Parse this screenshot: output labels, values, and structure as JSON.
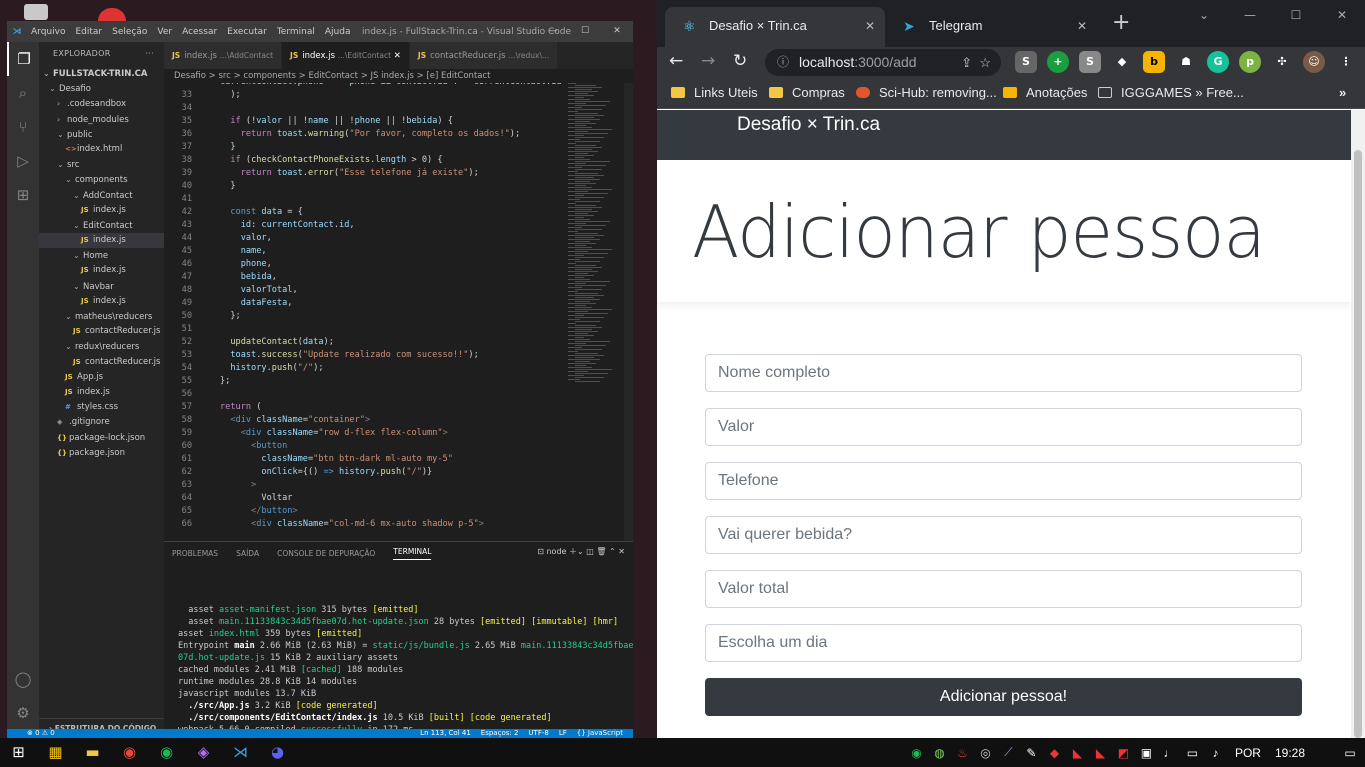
{
  "vscode": {
    "menu": [
      "Arquivo",
      "Editar",
      "Seleção",
      "Ver",
      "Acessar",
      "Executar",
      "Terminal",
      "Ajuda"
    ],
    "window_title": "index.js - FullStack-Trin.ca - Visual Studio Code",
    "explorer_label": "EXPLORADOR",
    "project": "FULLSTACK-TRIN.CA",
    "tree": [
      {
        "label": "Desafio",
        "type": "folder",
        "depth": 1
      },
      {
        "label": ".codesandbox",
        "type": "folder-closed",
        "depth": 2
      },
      {
        "label": "node_modules",
        "type": "folder-closed",
        "depth": 2
      },
      {
        "label": "public",
        "type": "folder",
        "depth": 2
      },
      {
        "label": "index.html",
        "type": "html",
        "depth": 3
      },
      {
        "label": "src",
        "type": "folder",
        "depth": 2
      },
      {
        "label": "components",
        "type": "folder",
        "depth": 3
      },
      {
        "label": "AddContact",
        "type": "folder",
        "depth": 4
      },
      {
        "label": "index.js",
        "type": "js",
        "depth": 5
      },
      {
        "label": "EditContact",
        "type": "folder",
        "depth": 4
      },
      {
        "label": "index.js",
        "type": "js",
        "depth": 5,
        "selected": true
      },
      {
        "label": "Home",
        "type": "folder",
        "depth": 4
      },
      {
        "label": "index.js",
        "type": "js",
        "depth": 5
      },
      {
        "label": "Navbar",
        "type": "folder",
        "depth": 4
      },
      {
        "label": "index.js",
        "type": "js",
        "depth": 5
      },
      {
        "label": "matheus\\reducers",
        "type": "folder",
        "depth": 3
      },
      {
        "label": "contactReducer.js",
        "type": "js",
        "depth": 4
      },
      {
        "label": "redux\\reducers",
        "type": "folder",
        "depth": 3
      },
      {
        "label": "contactReducer.js",
        "type": "js",
        "depth": 4
      },
      {
        "label": "App.js",
        "type": "js",
        "depth": 3
      },
      {
        "label": "index.js",
        "type": "js",
        "depth": 3
      },
      {
        "label": "styles.css",
        "type": "css",
        "depth": 3
      },
      {
        "label": ".gitignore",
        "type": "git",
        "depth": 2
      },
      {
        "label": "package-lock.json",
        "type": "json",
        "depth": 2
      },
      {
        "label": "package.json",
        "type": "json",
        "depth": 2
      }
    ],
    "outline_label": "ESTRUTURA DO CÓDIGO",
    "tabs": [
      {
        "name": "index.js",
        "sub": "...\\AddContact",
        "active": false
      },
      {
        "name": "index.js",
        "sub": "...\\EditContact",
        "active": true
      },
      {
        "name": "contactReducer.js",
        "sub": "...\\redux\\...",
        "active": false
      }
    ],
    "breadcrumb": "Desafio > src > components > EditContact > JS index.js > [e] EditContact",
    "code_lines": [
      {
        "n": "33",
        "html": "  );"
      },
      {
        "n": "34",
        "html": ""
      },
      {
        "n": "35",
        "html": "  <span class=\"k\">if</span> (!<span class=\"v\">valor</span> || !<span class=\"v\">name</span> || !<span class=\"v\">phone</span> || !<span class=\"v\">bebida</span>) {"
      },
      {
        "n": "36",
        "html": "    <span class=\"k\">return</span> <span class=\"v\">toast</span>.<span class=\"f\">warning</span>(<span class=\"s\">\"Por favor, completo os dados!\"</span>);"
      },
      {
        "n": "37",
        "html": "  }"
      },
      {
        "n": "38",
        "html": "  <span class=\"k\">if</span> (<span class=\"f\">checkContactPhoneExists</span>.<span class=\"v\">length</span> &gt; 0) {"
      },
      {
        "n": "39",
        "html": "    <span class=\"k\">return</span> <span class=\"v\">toast</span>.<span class=\"f\">error</span>(<span class=\"s\">\"Esse telefone já existe\"</span>);"
      },
      {
        "n": "40",
        "html": "  }"
      },
      {
        "n": "41",
        "html": ""
      },
      {
        "n": "42",
        "html": "  <span class=\"b\">const</span> <span class=\"v\">data</span> = {"
      },
      {
        "n": "43",
        "html": "    <span class=\"v\">id</span>: <span class=\"v\">currentContact</span>.<span class=\"v\">id</span>,"
      },
      {
        "n": "44",
        "html": "    <span class=\"v\">valor</span>,"
      },
      {
        "n": "45",
        "html": "    <span class=\"v\">name</span>,"
      },
      {
        "n": "46",
        "html": "    <span class=\"v\">phone</span>,"
      },
      {
        "n": "47",
        "html": "    <span class=\"v\">bebida</span>,"
      },
      {
        "n": "48",
        "html": "    <span class=\"v\">valorTotal</span>,"
      },
      {
        "n": "49",
        "html": "    <span class=\"v\">dataFesta</span>,"
      },
      {
        "n": "50",
        "html": "  };"
      },
      {
        "n": "51",
        "html": ""
      },
      {
        "n": "52",
        "html": "  <span class=\"f\">updateContact</span>(<span class=\"v\">data</span>);"
      },
      {
        "n": "53",
        "html": "  <span class=\"v\">toast</span>.<span class=\"f\">success</span>(<span class=\"s\">\"Update realizado com sucesso!!\"</span>);"
      },
      {
        "n": "54",
        "html": "  <span class=\"v\">history</span>.<span class=\"f\">push</span>(<span class=\"s\">\"/\"</span>);"
      },
      {
        "n": "55",
        "html": "};"
      },
      {
        "n": "56",
        "html": ""
      },
      {
        "n": "57",
        "html": "<span class=\"k\">return</span> ("
      },
      {
        "n": "58",
        "html": "  <span class=\"p\">&lt;</span><span class=\"b\">div</span> <span class=\"v\">className</span>=<span class=\"s\">\"container\"</span><span class=\"p\">&gt;</span>"
      },
      {
        "n": "59",
        "html": "    <span class=\"p\">&lt;</span><span class=\"b\">div</span> <span class=\"v\">className</span>=<span class=\"s\">\"row d-flex flex-column\"</span><span class=\"p\">&gt;</span>"
      },
      {
        "n": "60",
        "html": "      <span class=\"p\">&lt;</span><span class=\"b\">button</span>"
      },
      {
        "n": "61",
        "html": "        <span class=\"v\">className</span>=<span class=\"s\">\"btn btn-dark ml-auto my-5\"</span>"
      },
      {
        "n": "62",
        "html": "        <span class=\"v\">onClick</span>={() <span class=\"b\">=&gt;</span> <span class=\"v\">history</span>.<span class=\"f\">push</span>(<span class=\"s\">\"/\"</span>)}"
      },
      {
        "n": "63",
        "html": "      <span class=\"p\">&gt;</span>"
      },
      {
        "n": "64",
        "html": "        Voltar"
      },
      {
        "n": "65",
        "html": "      <span class=\"p\">&lt;/</span><span class=\"b\">button</span><span class=\"p\">&gt;</span>"
      },
      {
        "n": "66",
        "html": "      <span class=\"p\">&lt;</span><span class=\"b\">div</span> <span class=\"v\">className</span>=<span class=\"s\">\"col-md-6 mx-auto shadow p-5\"</span><span class=\"p\">&gt;</span>"
      }
    ],
    "panel_tabs": [
      "PROBLEMAS",
      "SAÍDA",
      "CONSOLE DE DEPURAÇÃO",
      "TERMINAL"
    ],
    "panel_shell": "node",
    "terminal_lines": [
      "  asset <span class=\"g\">asset-manifest.json</span> 315 bytes <span class=\"y\">[emitted]</span>",
      "  asset <span class=\"g\">main.11133843c34d5fbae07d.hot-update.json</span> 28 bytes <span class=\"y\">[emitted] [immutable] [hmr]</span>",
      "asset <span class=\"g\">index.html</span> 359 bytes <span class=\"y\">[emitted]</span>",
      "Entrypoint <span class=\"bw\">main</span> 2.66 MiB (2.63 MiB) = <span class=\"g\">static/js/bundle.js</span> 2.65 MiB <span class=\"g\">main.11133843c34d5fbae</span>",
      "<span class=\"g\">07d.hot-update.js</span> 15 KiB 2 auxiliary assets",
      "cached modules 2.41 MiB <span class=\"g\">[cached]</span> 188 modules",
      "runtime modules 28.8 KiB 14 modules",
      "javascript modules 13.7 KiB",
      "  <span class=\"bw\">./src/App.js</span> 3.2 KiB <span class=\"y\">[code generated]</span>",
      "  <span class=\"bw\">./src/components/EditContact/index.js</span> 10.5 KiB <span class=\"y\">[built] [code generated]</span>",
      "webpack 5.66.0 compiled <span class=\"g\">successfully</span> in 172 ms",
      "▯"
    ],
    "status_left": "⊗ 0 ⚠ 0",
    "status_right": [
      "Ln 113, Col 41",
      "Espaços: 2",
      "UTF-8",
      "LF",
      "{} JavaScript"
    ]
  },
  "browser": {
    "tabs": [
      {
        "title": "Desafio × Trin.ca",
        "active": true
      },
      {
        "title": "Telegram",
        "active": false
      }
    ],
    "url_host": "localhost",
    "url_path": ":3000/add",
    "bookmarks": [
      "Links Uteis",
      "Compras",
      "Sci-Hub: removing...",
      "Anotações",
      "IGGGAMES » Free..."
    ],
    "more_bookmarks": "»"
  },
  "app": {
    "brand": "Desafio × Trin.ca",
    "heading": "Adicionar pessoa",
    "placeholders": [
      "Nome completo",
      "Valor",
      "Telefone",
      "Vai querer bebida?",
      "Valor total",
      "Escolha um dia"
    ],
    "submit": "Adicionar pessoa!"
  },
  "taskbar": {
    "lang": "POR",
    "time": "19:28"
  },
  "colors": {
    "vscode_accent": "#007acc",
    "navbar": "#343a40",
    "chrome_dark": "#202124"
  }
}
